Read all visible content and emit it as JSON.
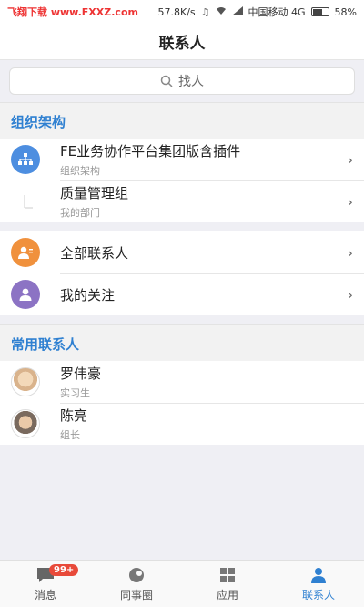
{
  "status_bar": {
    "left_text": "飞翔下载 www.FXXZ.com",
    "speed": "57.8K/s",
    "carrier": "中国移动 4G",
    "battery": "58%"
  },
  "header": {
    "title": "联系人"
  },
  "search": {
    "placeholder": "找人"
  },
  "org_section": {
    "title": "组织架构",
    "items": [
      {
        "title": "FE业务协作平台集团版含插件",
        "subtitle": "组织架构",
        "icon": "org-chart-icon"
      },
      {
        "title": "质量管理组",
        "subtitle": "我的部门",
        "icon": "department-icon"
      }
    ]
  },
  "contacts_section": {
    "items": [
      {
        "title": "全部联系人",
        "icon": "contacts-icon"
      },
      {
        "title": "我的关注",
        "icon": "follow-icon"
      }
    ]
  },
  "frequent_section": {
    "title": "常用联系人",
    "items": [
      {
        "name": "罗伟豪",
        "role": "实习生"
      },
      {
        "name": "陈亮",
        "role": "组长"
      }
    ]
  },
  "tabs": [
    {
      "label": "消息",
      "icon": "message-icon",
      "badge": "99+"
    },
    {
      "label": "同事圈",
      "icon": "colleague-circle-icon"
    },
    {
      "label": "应用",
      "icon": "apps-icon"
    },
    {
      "label": "联系人",
      "icon": "contacts-tab-icon",
      "active": true
    }
  ],
  "colors": {
    "accent": "#2f80d1",
    "badge": "#e84a3a",
    "org_icon": "#4d8ee0",
    "contacts_icon": "#f0913d",
    "follow_icon": "#8c73c4"
  }
}
